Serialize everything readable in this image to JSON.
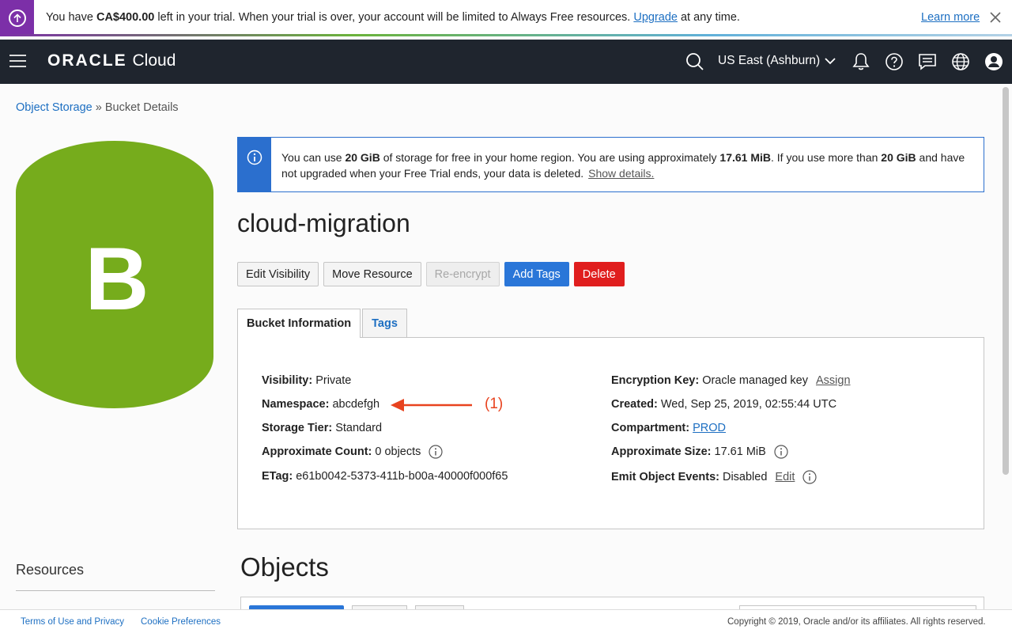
{
  "trial_banner": {
    "prefix": "You have ",
    "amount": "CA$400.00",
    "middle": " left in your trial. When your trial is over, your account will be limited to Always Free resources. ",
    "upgrade_link": "Upgrade",
    "suffix": " at any time.",
    "learn_more": "Learn more"
  },
  "header": {
    "logo_bold": "ORACLE",
    "logo_rest": "Cloud",
    "region": "US East (Ashburn)"
  },
  "breadcrumb": {
    "parent": "Object Storage",
    "separator": " » ",
    "current": "Bucket Details"
  },
  "bucket_icon": {
    "letter": "B",
    "color": "#76ac1c"
  },
  "info_banner": {
    "t1": "You can use ",
    "b1": "20 GiB",
    "t2": " of storage for free in your home region. You are using approximately ",
    "b2": "17.61 MiB",
    "t3": ". If you use more than ",
    "b3": "20 GiB",
    "t4": " and have not upgraded when your Free Trial ends, your data is deleted.",
    "link": "Show details."
  },
  "bucket_name": "cloud-migration",
  "actions": {
    "edit_visibility": "Edit Visibility",
    "move_resource": "Move Resource",
    "re_encrypt": "Re-encrypt",
    "add_tags": "Add Tags",
    "delete": "Delete"
  },
  "tabs": {
    "bucket_information": "Bucket Information",
    "tags": "Tags"
  },
  "details": {
    "visibility": {
      "label": "Visibility:",
      "value": "Private"
    },
    "namespace": {
      "label": "Namespace:",
      "value": "abcdefgh"
    },
    "storage_tier": {
      "label": "Storage Tier:",
      "value": "Standard"
    },
    "approx_count": {
      "label": "Approximate Count:",
      "value": "0 objects"
    },
    "etag": {
      "label": "ETag:",
      "value": "e61b0042-5373-411b-b00a-40000f000f65"
    },
    "encryption_key": {
      "label": "Encryption Key:",
      "value": "Oracle managed key",
      "link": "Assign"
    },
    "created": {
      "label": "Created:",
      "value": "Wed, Sep 25, 2019, 02:55:44 UTC"
    },
    "compartment": {
      "label": "Compartment:",
      "value": "PROD"
    },
    "approx_size": {
      "label": "Approximate Size:",
      "value": "17.61 MiB"
    },
    "emit_events": {
      "label": "Emit Object Events:",
      "value": "Disabled",
      "link": "Edit"
    }
  },
  "annotation": {
    "label": "(1)",
    "color": "#e8431f"
  },
  "resources_heading": "Resources",
  "objects_heading": "Objects",
  "footer": {
    "terms": "Terms of Use and Privacy",
    "cookies": "Cookie Preferences",
    "copyright": "Copyright © 2019, Oracle and/or its affiliates. All rights reserved."
  },
  "colors": {
    "trial_accent": "#7c2fa8",
    "header_bg": "#1f252e",
    "link": "#1d6fc2",
    "primary": "#2a76d8",
    "danger": "#e01e1e"
  }
}
